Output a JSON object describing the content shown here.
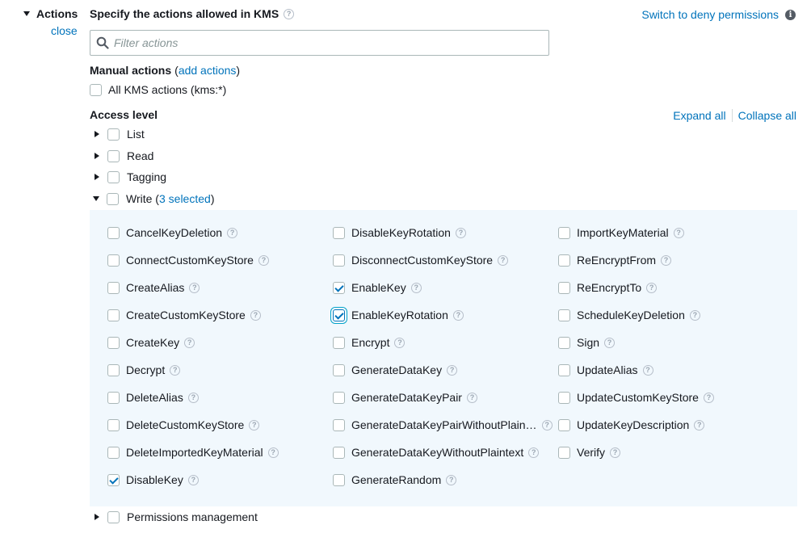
{
  "section": {
    "title": "Actions",
    "close_label": "close",
    "heading": "Specify the actions allowed in KMS",
    "switch_link": "Switch to deny permissions"
  },
  "filter": {
    "placeholder": "Filter actions"
  },
  "manual_actions": {
    "label": "Manual actions",
    "paren_open": "(",
    "add_link": "add actions",
    "paren_close": ")",
    "all_label": "All KMS actions (kms:*)"
  },
  "access_level": {
    "title": "Access level",
    "expand_all": "Expand all",
    "collapse_all": "Collapse all",
    "groups": [
      {
        "label": "List",
        "expanded": false
      },
      {
        "label": "Read",
        "expanded": false
      },
      {
        "label": "Tagging",
        "expanded": false
      },
      {
        "label": "Write",
        "expanded": true,
        "paren_open": " (",
        "selected_text": "3 selected",
        "paren_close": ")"
      },
      {
        "label": "Permissions management",
        "expanded": false
      }
    ]
  },
  "write_actions": {
    "columns": [
      [
        {
          "label": "CancelKeyDeletion",
          "checked": false
        },
        {
          "label": "ConnectCustomKeyStore",
          "checked": false
        },
        {
          "label": "CreateAlias",
          "checked": false
        },
        {
          "label": "CreateCustomKeyStore",
          "checked": false
        },
        {
          "label": "CreateKey",
          "checked": false
        },
        {
          "label": "Decrypt",
          "checked": false
        },
        {
          "label": "DeleteAlias",
          "checked": false
        },
        {
          "label": "DeleteCustomKeyStore",
          "checked": false
        },
        {
          "label": "DeleteImportedKeyMaterial",
          "checked": false
        },
        {
          "label": "DisableKey",
          "checked": true
        }
      ],
      [
        {
          "label": "DisableKeyRotation",
          "checked": false
        },
        {
          "label": "DisconnectCustomKeyStore",
          "checked": false
        },
        {
          "label": "EnableKey",
          "checked": true
        },
        {
          "label": "EnableKeyRotation",
          "checked": true,
          "focused": true
        },
        {
          "label": "Encrypt",
          "checked": false
        },
        {
          "label": "GenerateDataKey",
          "checked": false
        },
        {
          "label": "GenerateDataKeyPair",
          "checked": false
        },
        {
          "label": "GenerateDataKeyPairWithoutPlain…",
          "checked": false
        },
        {
          "label": "GenerateDataKeyWithoutPlaintext",
          "checked": false
        },
        {
          "label": "GenerateRandom",
          "checked": false
        }
      ],
      [
        {
          "label": "ImportKeyMaterial",
          "checked": false
        },
        {
          "label": "ReEncryptFrom",
          "checked": false
        },
        {
          "label": "ReEncryptTo",
          "checked": false
        },
        {
          "label": "ScheduleKeyDeletion",
          "checked": false
        },
        {
          "label": "Sign",
          "checked": false
        },
        {
          "label": "UpdateAlias",
          "checked": false
        },
        {
          "label": "UpdateCustomKeyStore",
          "checked": false
        },
        {
          "label": "UpdateKeyDescription",
          "checked": false
        },
        {
          "label": "Verify",
          "checked": false
        }
      ]
    ]
  },
  "icons": {
    "help": "?",
    "info": "i",
    "search": "search-icon",
    "expand": "caret-right-icon",
    "collapse": "caret-down-icon"
  },
  "colors": {
    "link": "#0073bb",
    "panel_bg": "#f1f8fd",
    "checkbox_border": "#aab7b8",
    "check_mark": "#0073bb"
  }
}
